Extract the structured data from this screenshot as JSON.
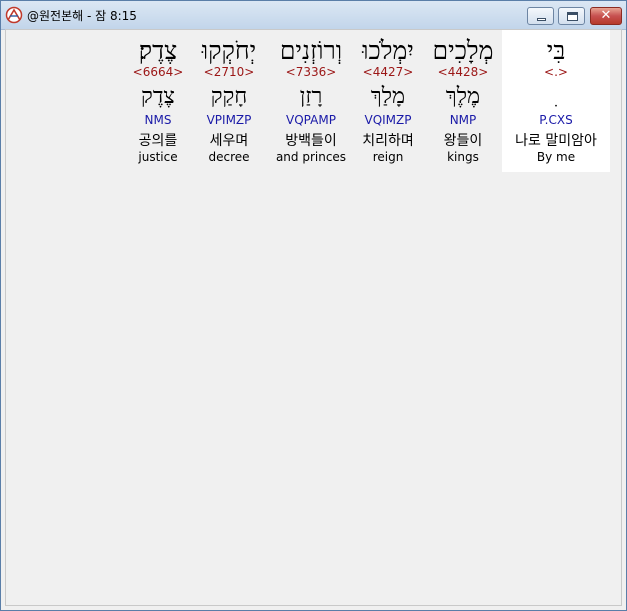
{
  "window": {
    "title": "@원전본해 - 잠 8:15",
    "close_glyph": "✕"
  },
  "words": [
    {
      "hebrew": "בִּי",
      "strong": "<.>",
      "root": "ִ",
      "parse": "P.CXS",
      "korean": "나로 말미암아",
      "english": "By me",
      "selected": true
    },
    {
      "hebrew": "מְלָכִים",
      "strong": "<4428>",
      "root": "מֶלֶךְ",
      "parse": "NMP",
      "korean": "왕들이",
      "english": "kings",
      "selected": false
    },
    {
      "hebrew": "יִמְלֹכוּ",
      "strong": "<4427>",
      "root": "מָלַךְ",
      "parse": "VQIMZP",
      "korean": "치리하며",
      "english": "reign",
      "selected": false
    },
    {
      "hebrew": "וְרוֹזְנִים",
      "strong": "<7336>",
      "root": "רָזַן",
      "parse": "VQPAMP",
      "korean": "방백들이",
      "english": "and princes",
      "selected": false
    },
    {
      "hebrew": "יְחֹקְקוּ",
      "strong": "<2710>",
      "root": "חָקַק",
      "parse": "VPIMZP",
      "korean": "세우며",
      "english": "decree",
      "selected": false
    },
    {
      "hebrew": "צֶדֶק׃",
      "strong": "<6664>",
      "root": "צֶדֶק",
      "parse": "NMS",
      "korean": "공의를",
      "english": "justice",
      "selected": false
    }
  ]
}
